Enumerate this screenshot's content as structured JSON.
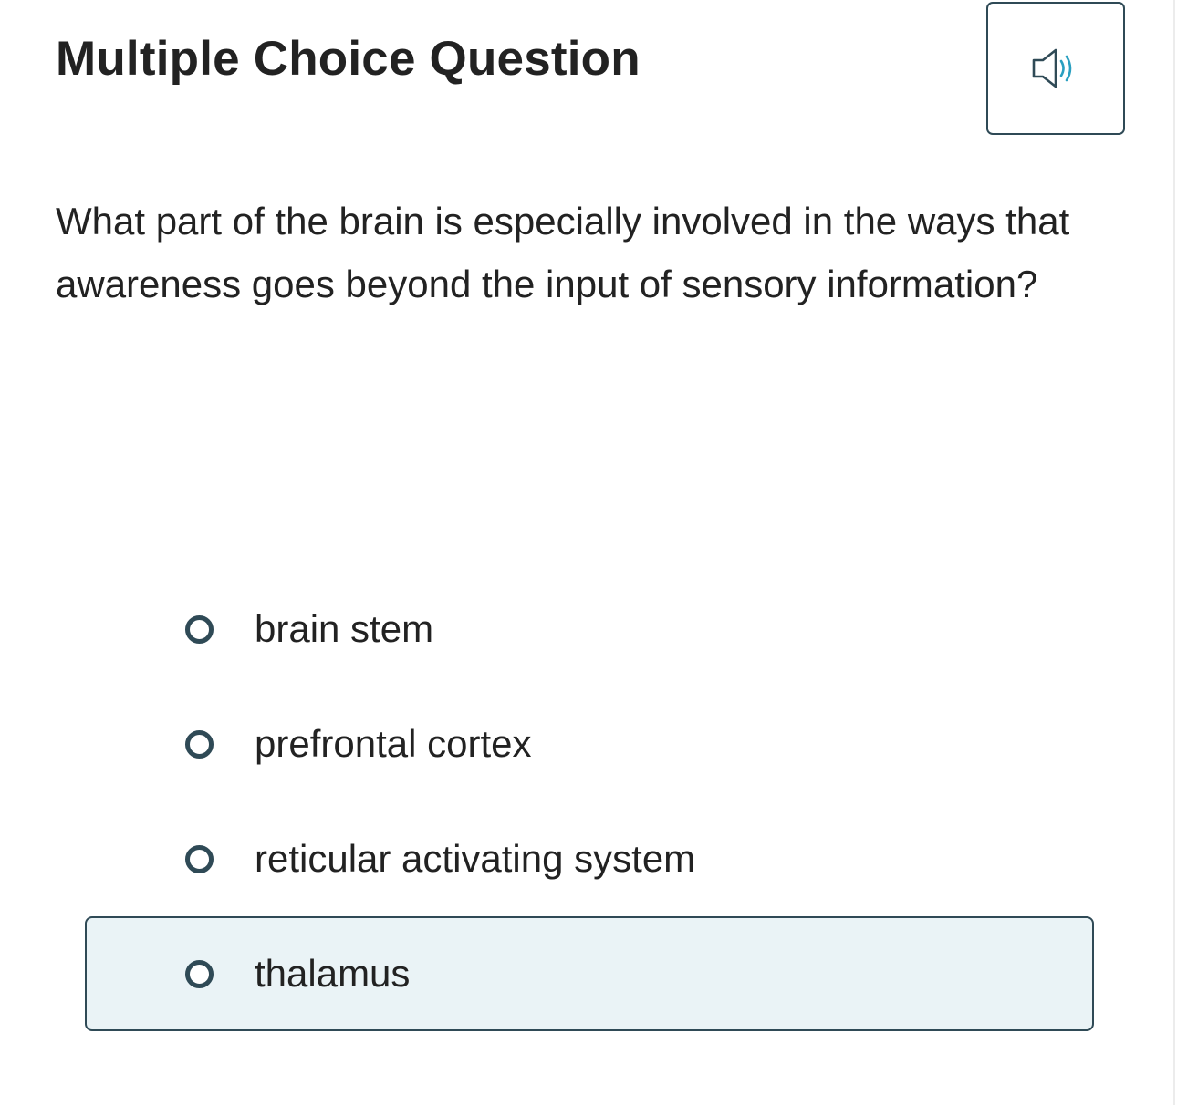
{
  "header": {
    "title": "Multiple Choice Question",
    "audio_button": {
      "icon": "speaker-icon",
      "icon_color": "#2f4a56",
      "wave_color": "#2a9fc0"
    }
  },
  "question": {
    "text": "What part of the brain is especially involved in the ways that awareness goes beyond the input of sensory information?"
  },
  "options": [
    {
      "label": "brain stem",
      "highlighted": false
    },
    {
      "label": "prefrontal cortex",
      "highlighted": false
    },
    {
      "label": "reticular activating system",
      "highlighted": false
    },
    {
      "label": "thalamus",
      "highlighted": true
    }
  ],
  "colors": {
    "accent_border": "#2f4a56",
    "highlight_bg": "#eaf3f6",
    "text": "#222222"
  }
}
